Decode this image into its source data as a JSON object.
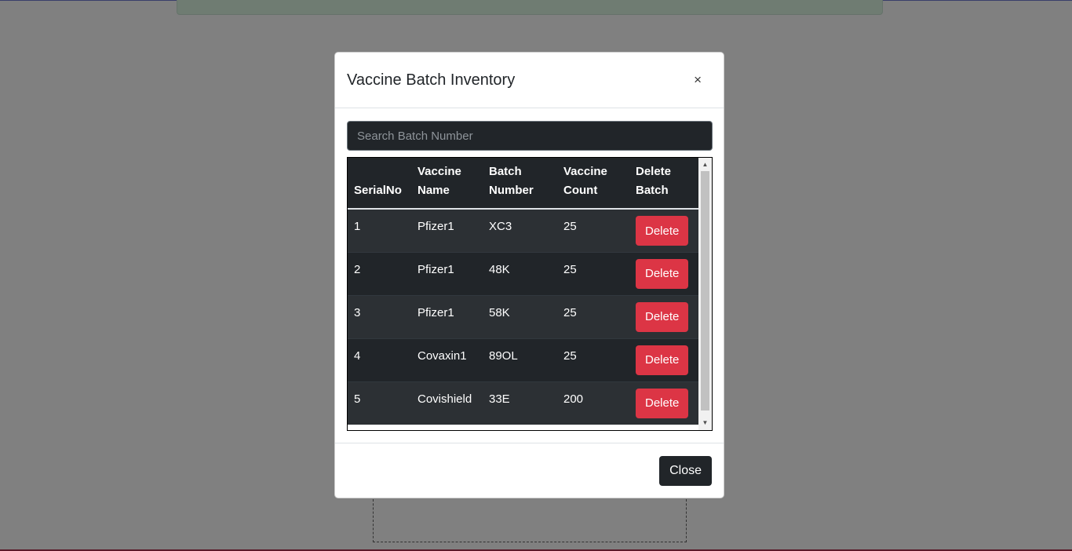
{
  "modal": {
    "title": "Vaccine Batch Inventory",
    "close_icon": "×",
    "close_button": "Close"
  },
  "search": {
    "placeholder": "Search Batch Number",
    "value": ""
  },
  "table": {
    "headers": {
      "serial": "SerialNo",
      "vaccine_name": "Vaccine Name",
      "batch_number": "Batch Number",
      "vaccine_count": "Vaccine Count",
      "delete_batch": "Delete Batch"
    },
    "rows": [
      {
        "serial": "1",
        "name": "Pfizer1",
        "batch": "XC3",
        "count": "25",
        "action": "Delete"
      },
      {
        "serial": "2",
        "name": "Pfizer1",
        "batch": "48K",
        "count": "25",
        "action": "Delete"
      },
      {
        "serial": "3",
        "name": "Pfizer1",
        "batch": "58K",
        "count": "25",
        "action": "Delete"
      },
      {
        "serial": "4",
        "name": "Covaxin1",
        "batch": "89OL",
        "count": "25",
        "action": "Delete"
      },
      {
        "serial": "5",
        "name": "Covishield",
        "batch": "33E",
        "count": "200",
        "action": "Delete"
      }
    ]
  },
  "scrollbar": {
    "up_icon": "▲",
    "down_icon": "▼"
  },
  "colors": {
    "overlay": "#808080",
    "danger": "#dc3545",
    "dark": "#212529"
  }
}
